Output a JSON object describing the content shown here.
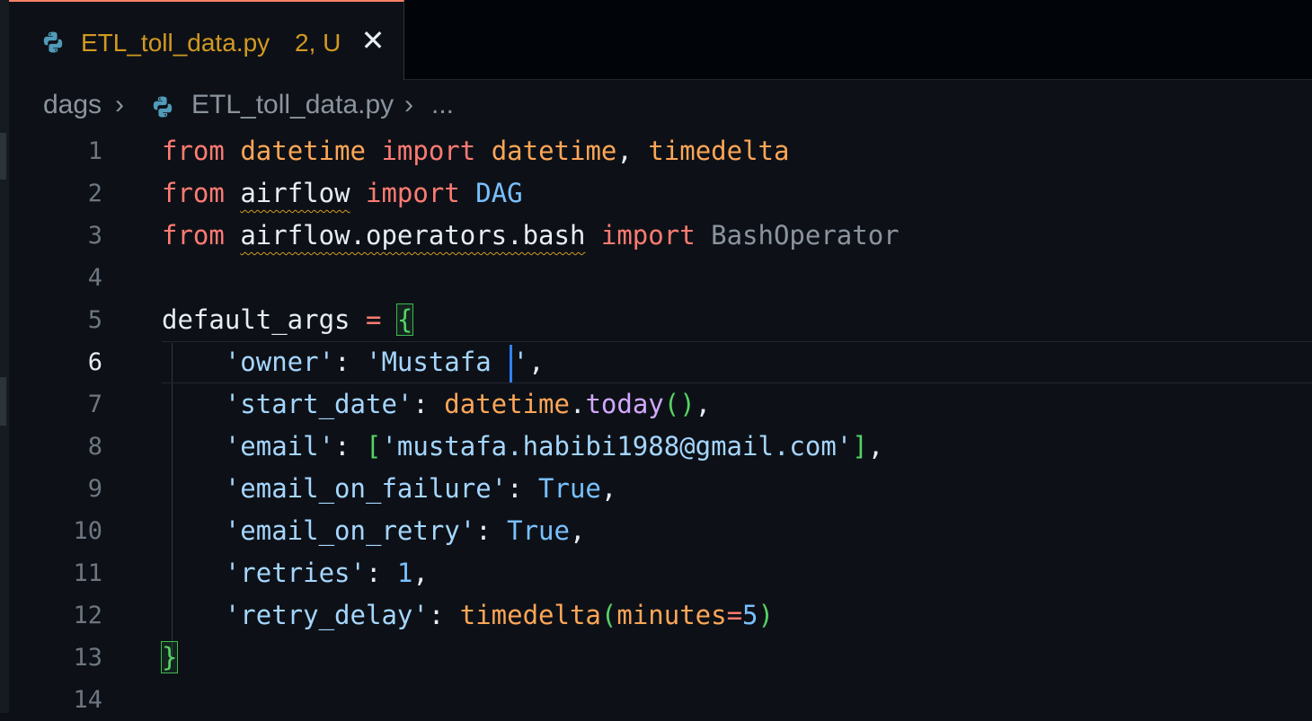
{
  "tab": {
    "filename": "ETL_toll_data.py",
    "badge": "2, U",
    "close_glyph": "✕",
    "icon": "python-icon",
    "modified_color": "#d29922"
  },
  "breadcrumb": {
    "folder": "dags",
    "separator": "›",
    "file": "ETL_toll_data.py",
    "more": "..."
  },
  "editor": {
    "current_line": 6,
    "line_numbers": [
      "1",
      "2",
      "3",
      "4",
      "5",
      "6",
      "7",
      "8",
      "9",
      "10",
      "11",
      "12",
      "13",
      "14"
    ],
    "code": {
      "l1": [
        "from",
        "datetime",
        "import",
        "datetime",
        ", ",
        "timedelta"
      ],
      "l2": [
        "from",
        "airflow",
        "import",
        "DAG"
      ],
      "l3": [
        "from",
        "airflow.operators.bash",
        "import",
        "BashOperator"
      ],
      "l5": [
        "default_args",
        " = ",
        "{"
      ],
      "l6": [
        "'owner'",
        ": ",
        "'Mustafa",
        "'",
        ","
      ],
      "l7": [
        "'start_date'",
        ": ",
        "datetime",
        ".",
        "today",
        "()",
        ","
      ],
      "l8": [
        "'email'",
        ": ",
        "[",
        "'mustafa.habibi1988@gmail.com'",
        "]",
        ","
      ],
      "l9": [
        "'email_on_failure'",
        ": ",
        "True",
        ","
      ],
      "l10": [
        "'email_on_retry'",
        ": ",
        "True",
        ","
      ],
      "l11": [
        "'retries'",
        ": ",
        "1",
        ","
      ],
      "l12": [
        "'retry_delay'",
        ": ",
        "timedelta",
        "(",
        "minutes",
        "=",
        "5",
        ")"
      ],
      "l13": [
        "}"
      ]
    }
  }
}
